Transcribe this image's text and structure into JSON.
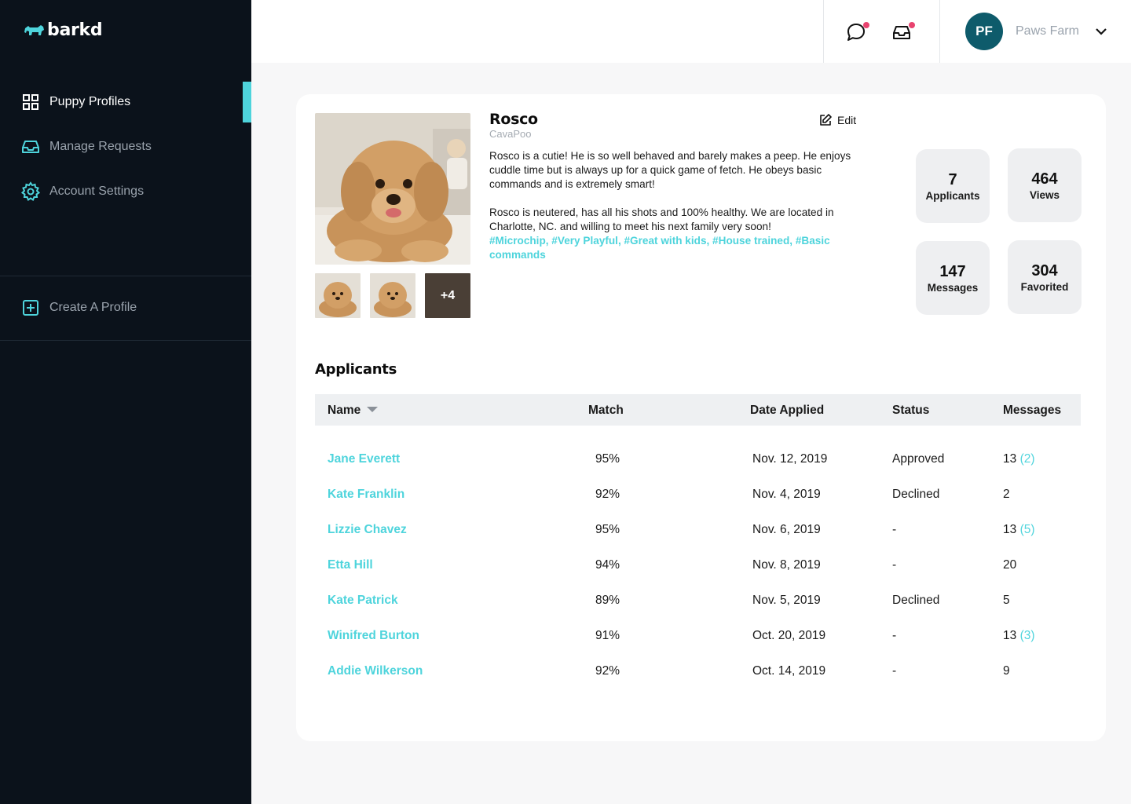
{
  "brand": {
    "name": "barkd",
    "accent": "#4ed4dc",
    "sidebar_bg": "#0b121b"
  },
  "sidebar": {
    "items": [
      {
        "label": "Puppy Profiles",
        "icon": "grid-icon",
        "active": true
      },
      {
        "label": "Manage Requests",
        "icon": "inbox-icon",
        "active": false
      },
      {
        "label": "Account Settings",
        "icon": "gear-icon",
        "active": false
      }
    ],
    "create": {
      "label": "Create A Profile",
      "icon": "plus-square-icon"
    }
  },
  "topbar": {
    "avatar_initials": "PF",
    "account_name": "Paws Farm",
    "chat_icon": "chat-bubble-icon",
    "inbox_icon": "inbox-icon",
    "notification_dot_color": "#e8436f"
  },
  "profile": {
    "name": "Rosco",
    "breed": "CavaPoo",
    "edit_label": "Edit",
    "description_1": "Rosco is a cutie! He is so well behaved and barely makes a peep. He enjoys cuddle time but is always up for a quick game of fetch. He obeys basic commands and is extremely smart!",
    "description_2": "Rosco is neutered, has all his shots and 100% healthy. We are located in Charlotte, NC. and willing to meet his next family very soon!",
    "tags": "#Microchip, #Very Playful, #Great with kids, #House trained, #Basic commands",
    "more_photos": "+4"
  },
  "stats": {
    "applicants": {
      "value": "7",
      "label": "Applicants"
    },
    "views": {
      "value": "464",
      "label": "Views"
    },
    "messages": {
      "value": "147",
      "label": "Messages"
    },
    "favorited": {
      "value": "304",
      "label": "Favorited"
    }
  },
  "applicants": {
    "title": "Applicants",
    "headers": {
      "name": "Name",
      "match": "Match",
      "date": "Date Applied",
      "status": "Status",
      "messages": "Messages"
    },
    "rows": [
      {
        "name": "Jane Everett",
        "match": "95%",
        "date": "Nov. 12, 2019",
        "status": "Approved",
        "messages": "13",
        "unread": "(2)"
      },
      {
        "name": "Kate Franklin",
        "match": "92%",
        "date": "Nov. 4, 2019",
        "status": "Declined",
        "messages": "2",
        "unread": ""
      },
      {
        "name": "Lizzie Chavez",
        "match": "95%",
        "date": "Nov. 6, 2019",
        "status": "-",
        "messages": "13",
        "unread": "(5)"
      },
      {
        "name": "Etta Hill",
        "match": "94%",
        "date": "Nov. 8, 2019",
        "status": "-",
        "messages": "20",
        "unread": ""
      },
      {
        "name": "Kate Patrick",
        "match": "89%",
        "date": "Nov. 5, 2019",
        "status": "Declined",
        "messages": "5",
        "unread": ""
      },
      {
        "name": "Winifred Burton",
        "match": "91%",
        "date": "Oct. 20, 2019",
        "status": "-",
        "messages": "13",
        "unread": "(3)"
      },
      {
        "name": "Addie Wilkerson",
        "match": "92%",
        "date": "Oct. 14, 2019",
        "status": "-",
        "messages": "9",
        "unread": ""
      }
    ]
  }
}
